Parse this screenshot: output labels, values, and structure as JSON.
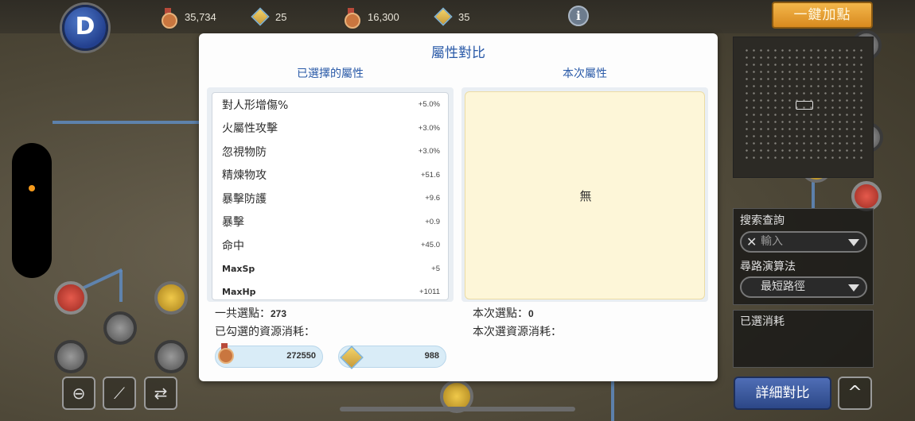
{
  "topbar": {
    "resources": [
      {
        "icon": "medal-icon",
        "value": "35,734"
      },
      {
        "icon": "gem-icon",
        "value": "25"
      },
      {
        "icon": "locked-medal-icon",
        "value": "16,300"
      },
      {
        "icon": "locked-gem-icon",
        "value": "35"
      }
    ],
    "info_icon": "i",
    "auto_add_label": "一鍵加點",
    "back_icon": "D"
  },
  "dialog": {
    "title": "屬性對比",
    "selected_header": "已選擇的屬性",
    "current_header": "本次屬性",
    "attributes": [
      {
        "name": "對人形增傷%",
        "value": "+5.0%"
      },
      {
        "name": "火屬性攻擊",
        "value": "+3.0%"
      },
      {
        "name": "忽視物防",
        "value": "+3.0%"
      },
      {
        "name": "精煉物攻",
        "value": "+51.6"
      },
      {
        "name": "暴擊防護",
        "value": "+9.6"
      },
      {
        "name": "暴擊",
        "value": "+0.9"
      },
      {
        "name": "命中",
        "value": "+45.0"
      },
      {
        "name": "MaxSp",
        "value": "+5"
      },
      {
        "name": "MaxHp",
        "value": "+1011"
      }
    ],
    "none_text": "無",
    "total_points_label": "一共選點：",
    "total_points_value": "273",
    "checked_cost_label": "已勾選的資源消耗：",
    "current_points_label": "本次選點：",
    "current_points_value": "0",
    "current_cost_label": "本次選資源消耗：",
    "costs": [
      {
        "icon": "medal-icon",
        "value": "272550"
      },
      {
        "icon": "gem-icon",
        "value": "988"
      }
    ]
  },
  "side": {
    "search_label": "搜索查詢",
    "search_placeholder": "輸入",
    "algo_label": "尋路演算法",
    "algo_selected": "最短路徑",
    "consumed_label": "已選消耗",
    "detail_button": "詳細對比",
    "up_icon": "^"
  },
  "tools": [
    "zoom-out-icon",
    "slash-icon",
    "swap-icon"
  ]
}
